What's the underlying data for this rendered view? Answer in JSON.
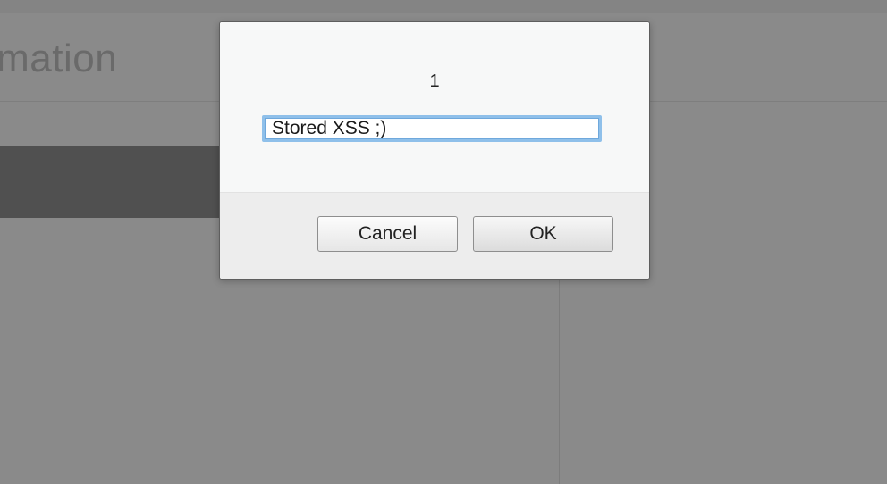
{
  "background_page": {
    "title_fragment": "ormation"
  },
  "prompt_dialog": {
    "message": "1",
    "input_value": "Stored XSS ;)",
    "cancel_label": "Cancel",
    "ok_label": "OK"
  }
}
